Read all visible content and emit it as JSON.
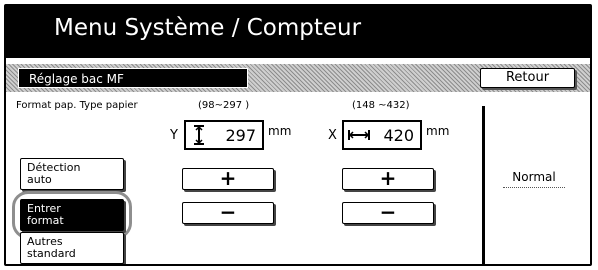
{
  "header": {
    "title": "Menu Système / Compteur"
  },
  "section": {
    "label": "Réglage bac MF",
    "back_label": "Retour"
  },
  "paper": {
    "format_label": "Format pap. Type papier",
    "y_range": "(98~297 )",
    "x_range": "(148 ~432)",
    "y_axis": "Y",
    "x_axis": "X",
    "y_value": "297",
    "x_value": "420",
    "unit": "mm",
    "plus_label": "+",
    "minus_label": "−"
  },
  "side_buttons": {
    "detection_line1": "Détection",
    "detection_line2": "auto",
    "entrer_line1": "Entrer",
    "entrer_line2": "format",
    "autres_line1": "Autres",
    "autres_line2": "standard"
  },
  "paper_type": {
    "value": "Normal"
  },
  "colors": {
    "title_bar": "#000000",
    "selected": "#000000",
    "highlight": "#8e8e8e"
  }
}
